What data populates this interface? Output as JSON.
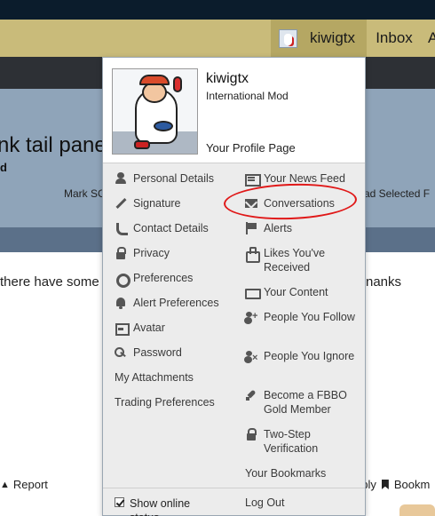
{
  "navbar": {
    "username": "kiwigtx",
    "inbox_label": "Inbox",
    "more_label": "A"
  },
  "page": {
    "title_fragment": "nk tail pane",
    "subtitle_fragment": "d",
    "mark_read_fragment": "Mark SC",
    "right_links_fragment": "ad   Selected F",
    "body_left_fragment": "there have some",
    "body_right_fragment": "nanks",
    "report_label": "Report",
    "reply_label": "eply",
    "bookmark_label": "Bookm"
  },
  "dropdown": {
    "username": "kiwigtx",
    "role": "International Mod",
    "profile_link": "Your Profile Page",
    "left_menu": [
      {
        "label": "Personal Details",
        "icon": "user-icon"
      },
      {
        "label": "Signature",
        "icon": "pencil-icon"
      },
      {
        "label": "Contact Details",
        "icon": "phone-icon"
      },
      {
        "label": "Privacy",
        "icon": "lock-icon"
      },
      {
        "label": "Preferences",
        "icon": "gear-icon"
      },
      {
        "label": "Alert Preferences",
        "icon": "bell-icon"
      },
      {
        "label": "Avatar",
        "icon": "image-icon"
      },
      {
        "label": "Password",
        "icon": "key-icon"
      },
      {
        "label": "My Attachments",
        "icon": ""
      },
      {
        "label": "Trading Preferences",
        "icon": ""
      }
    ],
    "right_menu": [
      {
        "label": "Your News Feed",
        "icon": "newspaper-icon"
      },
      {
        "label": "Conversations",
        "icon": "envelope-icon"
      },
      {
        "label": "Alerts",
        "icon": "flag-icon"
      },
      {
        "label": "Likes You've Received",
        "icon": "thumbs-up-icon"
      },
      {
        "label": "Your Content",
        "icon": "keyboard-icon"
      },
      {
        "label": "People You Follow",
        "icon": "user-plus-icon"
      },
      {
        "label": "People You Ignore",
        "icon": "user-times-icon"
      },
      {
        "label": "Become a FBBO Gold Member",
        "icon": "rocket-icon"
      },
      {
        "label": "Two-Step Verification",
        "icon": "lock-icon"
      },
      {
        "label": "Your Bookmarks",
        "icon": ""
      }
    ],
    "show_online_status": "Show online status",
    "logout_label": "Log Out"
  },
  "colors": {
    "navbar": "#c9bb7a",
    "navbar_active": "#b5a763",
    "dropdown_bg": "#ececec",
    "annotation_red": "#e01818"
  }
}
